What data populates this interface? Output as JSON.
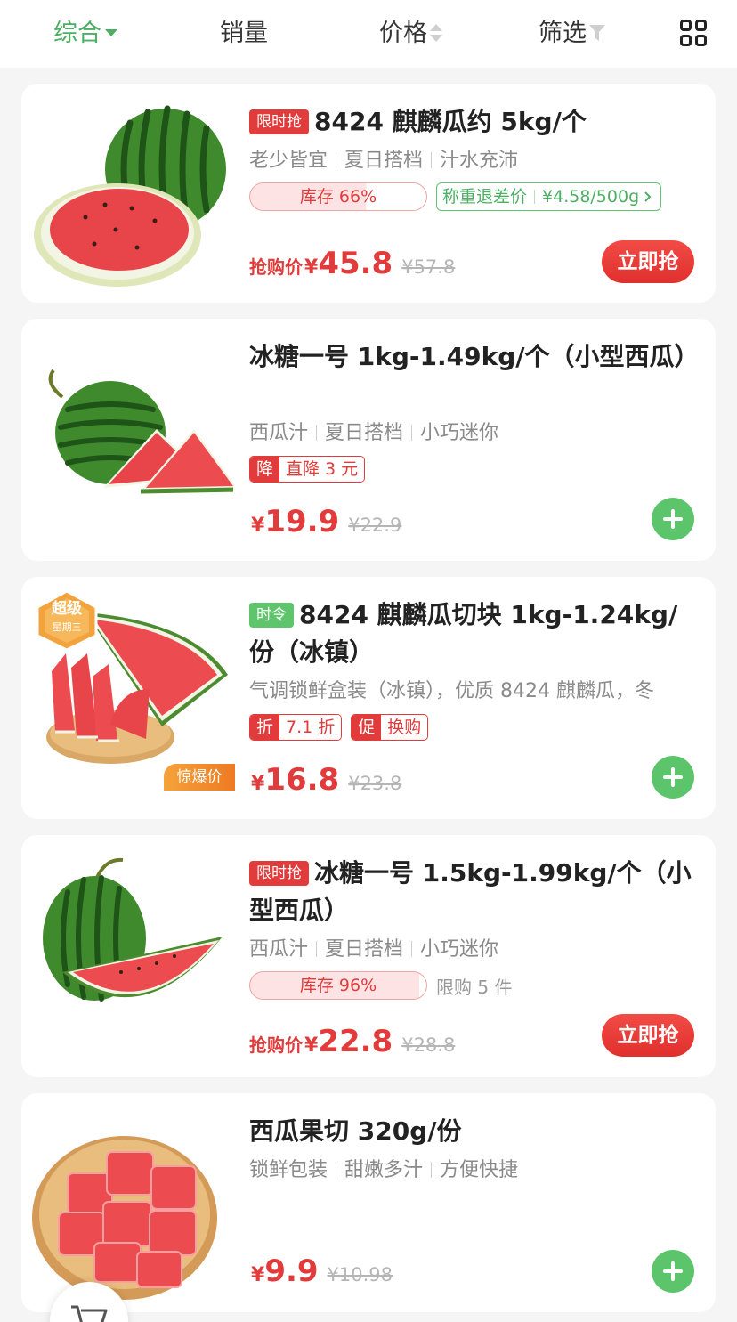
{
  "sort_bar": {
    "items": [
      {
        "label": "综合",
        "active": true
      },
      {
        "label": "销量",
        "active": false
      },
      {
        "label": "价格",
        "active": false
      },
      {
        "label": "筛选",
        "active": false
      }
    ],
    "layout_toggle_icon": "grid-view-icon"
  },
  "products": [
    {
      "tag": "限时抢",
      "title": "8424 麒麟瓜约 5kg/个",
      "subtitles": [
        "老少皆宜",
        "夏日搭档",
        "汁水充沛"
      ],
      "stock": "库存 66%",
      "stock_fraction": 0.66,
      "weigh": {
        "label": "称重退差价",
        "value": "¥4.58/500g"
      },
      "price_label": "抢购价",
      "currency": "¥",
      "price": "45.8",
      "original_price": "¥57.8",
      "action": "立即抢"
    },
    {
      "title": "冰糖一号 1kg-1.49kg/个（小型西瓜）",
      "subtitles": [
        "西瓜汁",
        "夏日搭档",
        "小巧迷你"
      ],
      "promos": [
        {
          "key": "降",
          "value": "直降 3 元"
        }
      ],
      "currency": "¥",
      "price": "19.9",
      "original_price": "¥22.9",
      "action_icon": "add-icon"
    },
    {
      "tag": "时令",
      "title": "8424 麒麟瓜切块 1kg-1.24kg/份（冰镇）",
      "description": "气调锁鲜盒装（冰镇），优质 8424 麒麟瓜，冬",
      "promos": [
        {
          "key": "折",
          "value": "7.1 折"
        },
        {
          "key": "促",
          "value": "换购"
        }
      ],
      "badge": "惊爆价",
      "super_badge": {
        "line1": "超级",
        "line2": "星期三"
      },
      "currency": "¥",
      "price": "16.8",
      "original_price": "¥23.8",
      "action_icon": "add-icon"
    },
    {
      "tag": "限时抢",
      "title": "冰糖一号 1.5kg-1.99kg/个（小型西瓜）",
      "subtitles": [
        "西瓜汁",
        "夏日搭档",
        "小巧迷你"
      ],
      "stock": "库存 96%",
      "stock_fraction": 0.96,
      "limit": "限购 5 件",
      "price_label": "抢购价",
      "currency": "¥",
      "price": "22.8",
      "original_price": "¥28.8",
      "action": "立即抢"
    },
    {
      "title": "西瓜果切 320g/份",
      "subtitles": [
        "锁鲜包装",
        "甜嫩多汁",
        "方便快捷"
      ],
      "currency": "¥",
      "price": "9.9",
      "original_price": "¥10.98",
      "action_icon": "add-icon"
    }
  ],
  "colors": {
    "accent_green": "#4caf63",
    "price_red": "#e23b3b",
    "badge_orange": "#f08a2a"
  }
}
